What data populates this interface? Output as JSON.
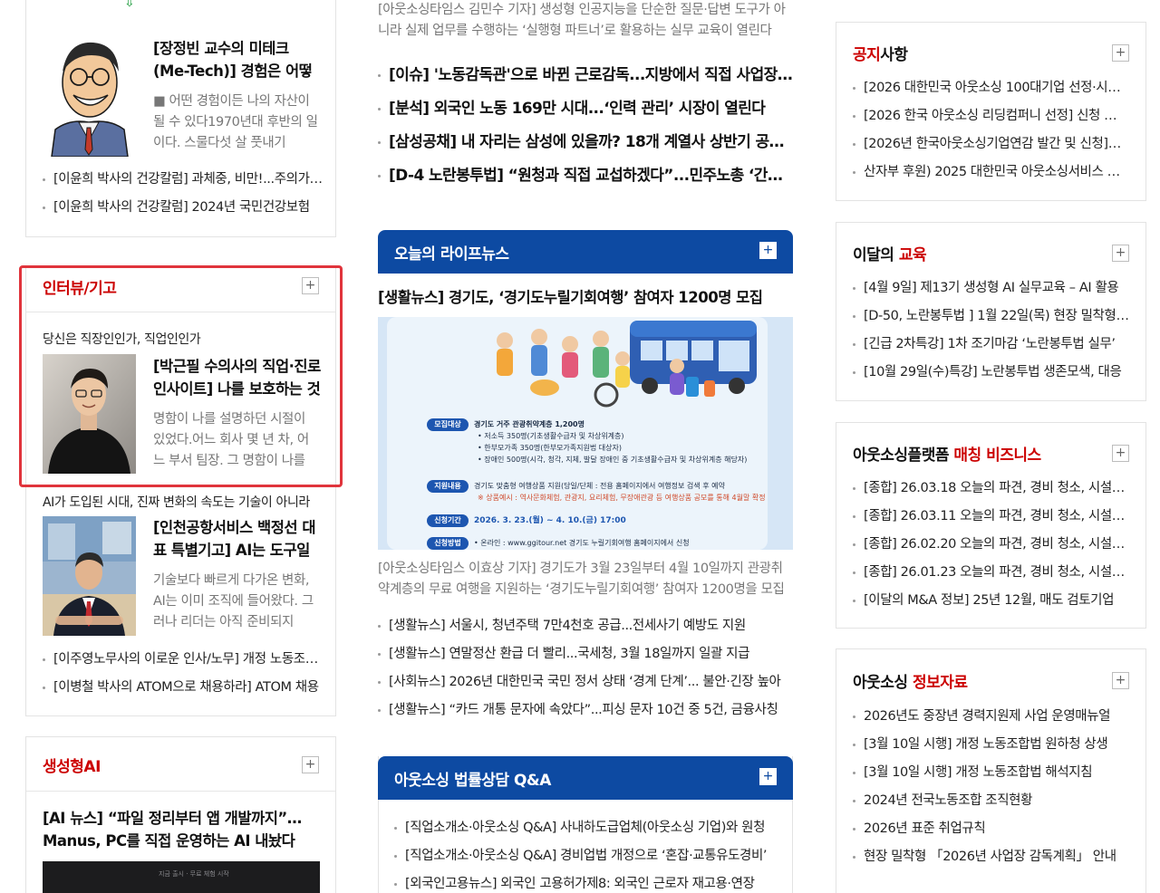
{
  "left": {
    "top_lead": {
      "title": "[장정빈 교수의 미테크(Me-Tech)] 경험은 어떻게 지렛대가 되는가",
      "summary": "■ 어떤 경험이든 나의 자산이 될 수 있다1970년대 후반의 일이다. 스물다섯 살 풋내기"
    },
    "top_items": [
      "[이윤희 박사의 건강칼럼] 과체중, 비만!...주의가 필요합니다",
      "[이윤희 박사의 건강칼럼] 2024년 국민건강보험"
    ],
    "interview": {
      "title_a": "인터뷰",
      "title_b": "/기고",
      "plus": "+",
      "kicker": "당신은 직장인인가, 직업인인가",
      "lead_title": "[박근필 수의사의 직업·진로 인사이트] 나를 보호하는 것은",
      "lead_summary": "명함이 나를 설명하던 시절이 있었다.어느 회사 몇 년 차, 어느 부서 팀장. 그 명함이 나를",
      "kicker2": "AI가 도입된 시대, 진짜 변화의 속도는 기술이 아니라",
      "lead2_title": "[인천공항서비스 백정선 대표 특별기고] AI는 도구일 뿐",
      "lead2_summary": "기술보다 빠르게 다가온 변화, AI는 이미 조직에 들어왔다. 그러나 리더는 아직 준비되지",
      "items": [
        "[이주영노무사의 이로운 인사/노무] 개정 노동조합법",
        "[이병철 박사의 ATOM으로 채용하라] ATOM 채용"
      ]
    },
    "genai": {
      "title": "생성형AI",
      "plus": "+",
      "lead_title": "[AI 뉴스] “파일 정리부터 앱 개발까지”… Manus, PC를 직접 운영하는 AI 내놨다",
      "screen_text": "지금 출시 · 무료 체험 시작"
    }
  },
  "center": {
    "top_summary": "[아웃소싱타임스 김민수 기자] 생성형 인공지능을 단순한 질문·답변 도구가 아니라 실제 업무를 수행하는 ‘실행형 파트너’로 활용하는 실무 교육이 열린다",
    "top_items": [
      "[이슈] '노동감독관'으로 바뀐 근로감독...지방에서 직접 사업장 감독",
      "[분석] 외국인 노동 169만 시대...‘인력 관리’ 시장이 열린다",
      "[삼성공채] 내 자리는 삼성에 있을까? 18개 계열사 상반기 공채 시작",
      "[D-4 노란봉투법] “원청과 직접 교섭하겠다”...민주노총 ‘간접고용’ 총력"
    ],
    "life": {
      "bar_title": "오늘의 라이프뉴스",
      "plus": "+",
      "headline": "[생활뉴스] 경기도, ‘경기도누릴기회여행’ 참여자 1200명 모집",
      "poster": {
        "rows": [
          {
            "tag": "모집대상",
            "lines": [
              "경기도 거주 관광취약계층 1,200명",
              "• 저소득 350명(기초생활수급자 및 차상위계층)",
              "• 한부모가족 350명(한부모가족지원법 대상자)",
              "• 장애인 500명(시각, 청각, 지체, 발달 장애인 중 기초생활수급자 및 차상위계층 해당자)"
            ]
          },
          {
            "tag": "지원내용",
            "lines": [
              "경기도 맞춤형 여행상품 지원(당일/단체 : 전용 홈페이지에서 여행정보 검색 후 예약",
              "※ 상품예시 : 역사문화체험, 관광지, 요리체험, 무장애관광 등 여행상품 공모를 통해 4월말 확정"
            ]
          },
          {
            "tag": "신청기간",
            "lines": [
              "2026. 3. 23.(월) ~ 4. 10.(금) 17:00"
            ]
          },
          {
            "tag": "신청방법",
            "lines": [
              "• 온라인 : www.ggitour.net 경기도 누릴기회여행 홈페이지에서 신청"
            ]
          }
        ]
      },
      "summary": "[아웃소싱타임스 이효상 기자] 경기도가 3월 23일부터 4월 10일까지 관광취약계층의 무료 여행을 지원하는 ‘경기도누릴기회여행’ 참여자 1200명을 모집한다",
      "items": [
        "[생활뉴스] 서울시, 청년주택 7만4천호 공급...전세사기 예방도 지원",
        "[생활뉴스] 연말정산 환급 더 빨리...국세청, 3월 18일까지 일괄 지급",
        "[사회뉴스] 2026년 대한민국 국민 정서 상태 ‘경계 단계’... 불안·긴장 높아",
        "[생활뉴스] “카드 개통 문자에 속았다”...피싱 문자 10건 중 5건, 금융사칭"
      ]
    },
    "legal": {
      "bar_title": "아웃소싱 법률상담 Q&A",
      "plus": "+",
      "items": [
        "[직업소개소·아웃소싱 Q&A] 사내하도급업체(아웃소싱 기업)와 원청",
        "[직업소개소·아웃소싱 Q&A] 경비업법 개정으로 ‘혼잡·교통유도경비’",
        "[외국인고용뉴스] 외국인 고용허가제8: 외국인 근로자 재고용·연장"
      ]
    }
  },
  "right": {
    "notice": {
      "title_a": "공지",
      "title_b": "사항",
      "plus": "+",
      "items": [
        "[2026 대한민국 아웃소싱 100대기업 선정·시상식] 안내",
        "[2026 한국 아웃소싱 리딩컴퍼니 선정] 신청 안내",
        "[2026년 한국아웃소싱기업연감 발간 및 신청] 안내",
        "산자부 후원) 2025 대한민국 아웃소싱서비스 대상"
      ]
    },
    "edu": {
      "title_a": "이달의 ",
      "title_b": "교육",
      "plus": "+",
      "items": [
        "[4월 9일] 제13기 생성형 AI 실무교육 – AI 활용",
        "[D-50, 노란봉투법 ] 1월 22일(목) 현장 밀착형 교육",
        "[긴급 2차특강] 1차 조기마감 ‘노란봉투법 실무’",
        "[10월 29일(수)특강] 노란봉투법 생존모색, 대응"
      ]
    },
    "platform": {
      "title_a": "아웃소싱플랫폼 ",
      "title_b": "매칭 비즈니스",
      "plus": "+",
      "items": [
        "[종합] 26.03.18 오늘의 파견, 경비 청소, 시설관리",
        "[종합] 26.03.11 오늘의 파견, 경비 청소, 시설관리",
        "[종합] 26.02.20 오늘의 파견, 경비 청소, 시설관리",
        "[종합] 26.01.23 오늘의 파견, 경비 청소, 시설관리",
        "[이달의 M&A 정보] 25년 12월, 매도 검토기업"
      ]
    },
    "info": {
      "title_a": "아웃소싱 ",
      "title_b": "정보자료",
      "plus": "+",
      "items": [
        "2026년도 중장년 경력지원제 사업 운영매뉴얼",
        "[3월 10일 시행] 개정 노동조합법 원하청 상생",
        "[3월 10일 시행] 개정 노동조합법 해석지침",
        "2024년 전국노동조합 조직현황",
        "2026년 표준 취업규칙",
        "현장 밀착형 「2026년 사업장 감독계획」 안내"
      ]
    }
  },
  "colors": {
    "accent_red": "#cc0000",
    "bar_blue": "#0d4aa2",
    "highlight": "#e0343c"
  }
}
